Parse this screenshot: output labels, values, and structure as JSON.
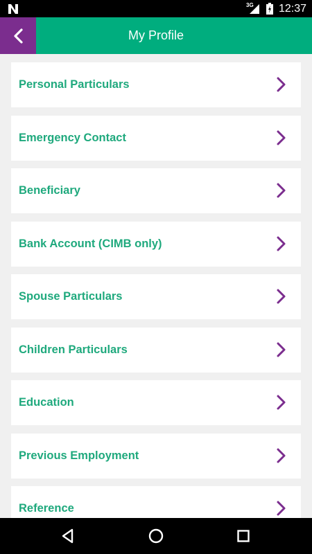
{
  "status_bar": {
    "network_label": "3G",
    "time": "12:37"
  },
  "header": {
    "title": "My Profile",
    "back_icon": "chevron-left-icon"
  },
  "menu": {
    "items": [
      {
        "label": "Personal Particulars"
      },
      {
        "label": "Emergency Contact"
      },
      {
        "label": "Beneficiary"
      },
      {
        "label": "Bank Account (CIMB only)"
      },
      {
        "label": "Spouse Particulars"
      },
      {
        "label": "Children Particulars"
      },
      {
        "label": "Education"
      },
      {
        "label": "Previous Employment"
      },
      {
        "label": "Reference"
      }
    ],
    "chevron_icon": "chevron-right-icon"
  },
  "colors": {
    "app_bar": "#00ad7e",
    "back_button": "#7b2d8e",
    "item_text": "#1fa97d",
    "chevron": "#7b2d8e",
    "background": "#f0f0f0"
  },
  "nav_bar": {
    "icons": [
      "back-triangle-icon",
      "home-circle-icon",
      "recents-square-icon"
    ]
  }
}
